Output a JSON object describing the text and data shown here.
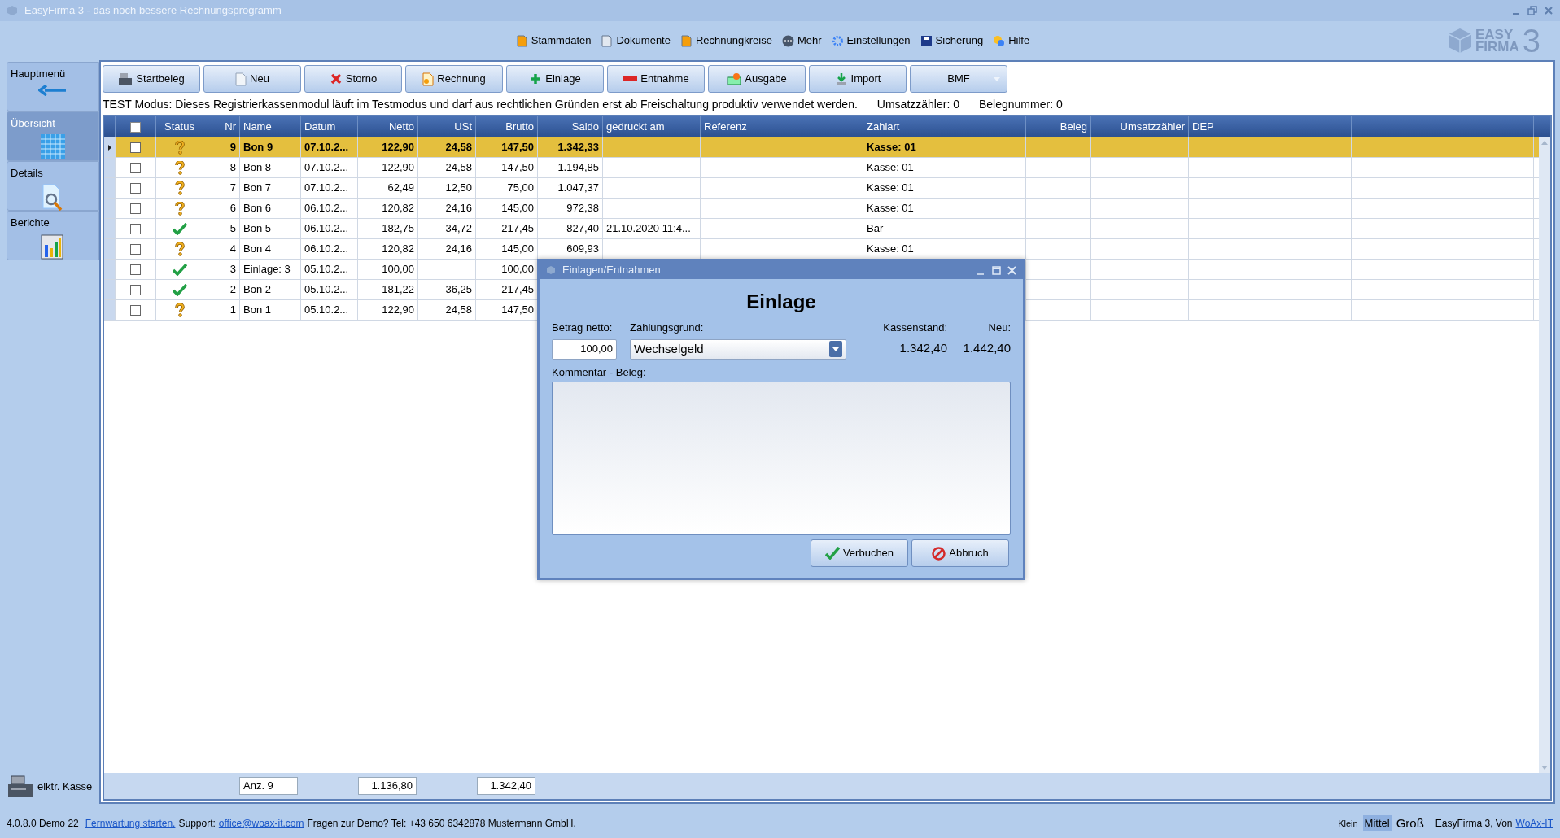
{
  "window": {
    "title": "EasyFirma 3 - das noch bessere Rechnungsprogramm"
  },
  "menu": [
    {
      "label": "Stammdaten"
    },
    {
      "label": "Dokumente"
    },
    {
      "label": "Rechnungkreise"
    },
    {
      "label": "Mehr"
    },
    {
      "label": "Einstellungen"
    },
    {
      "label": "Sicherung"
    },
    {
      "label": "Hilfe"
    }
  ],
  "logo": {
    "line1": "EASY",
    "line2": "FIRMA",
    "digit": "3"
  },
  "sidebar": {
    "items": [
      {
        "label": "Hauptmenü",
        "selected": false
      },
      {
        "label": "Übersicht",
        "selected": true
      },
      {
        "label": "Details",
        "selected": false
      },
      {
        "label": "Berichte",
        "selected": false
      }
    ],
    "footer": "elktr. Kasse"
  },
  "toolbar": [
    {
      "label": "Startbeleg",
      "dropdown": false
    },
    {
      "label": "Neu",
      "dropdown": false
    },
    {
      "label": "Storno",
      "dropdown": false
    },
    {
      "label": "Rechnung",
      "dropdown": false
    },
    {
      "label": "Einlage",
      "dropdown": false
    },
    {
      "label": "Entnahme",
      "dropdown": false
    },
    {
      "label": "Ausgabe",
      "dropdown": false
    },
    {
      "label": "Import",
      "dropdown": false
    },
    {
      "label": "BMF",
      "dropdown": true
    }
  ],
  "notice": "TEST Modus: Dieses Registrierkassenmodul läuft im Testmodus und darf aus rechtlichen Gründen erst ab Freischaltung produktiv verwendet werden.",
  "counters": [
    {
      "label": "Umsatzzähler:",
      "value": "0"
    },
    {
      "label": "Belegnummer:",
      "value": "0"
    }
  ],
  "table": {
    "select_all_checked": false,
    "columns": [
      "Status",
      "Nr",
      "Name",
      "Datum",
      "Netto",
      "USt",
      "Brutto",
      "Saldo",
      "gedruckt am",
      "Referenz",
      "Zahlart",
      "Beleg",
      "Umsatzzähler",
      "DEP"
    ],
    "rows": [
      {
        "selected": true,
        "checked": false,
        "kind": "open",
        "cells": [
          "",
          "9",
          "Bon 9",
          "07.10.2...",
          "122,90",
          "24,58",
          "147,50",
          "1.342,33",
          "",
          "",
          "Kasse: 01"
        ]
      },
      {
        "selected": false,
        "checked": false,
        "kind": "open",
        "cells": [
          "",
          "8",
          "Bon 8",
          "07.10.2...",
          "122,90",
          "24,58",
          "147,50",
          "1.194,85",
          "",
          "",
          "Kasse: 01"
        ]
      },
      {
        "selected": false,
        "checked": false,
        "kind": "open",
        "cells": [
          "",
          "7",
          "Bon 7",
          "07.10.2...",
          "62,49",
          "12,50",
          "75,00",
          "1.047,37",
          "",
          "",
          "Kasse: 01"
        ]
      },
      {
        "selected": false,
        "checked": false,
        "kind": "open",
        "cells": [
          "",
          "6",
          "Bon 6",
          "06.10.2...",
          "120,82",
          "24,16",
          "145,00",
          "972,38",
          "",
          "",
          "Kasse: 01"
        ]
      },
      {
        "selected": false,
        "checked": false,
        "kind": "done",
        "cells": [
          "",
          "5",
          "Bon 5",
          "06.10.2...",
          "182,75",
          "34,72",
          "217,45",
          "827,40",
          "21.10.2020 11:4...",
          "",
          "Bar"
        ]
      },
      {
        "selected": false,
        "checked": false,
        "kind": "open",
        "cells": [
          "",
          "4",
          "Bon 4",
          "06.10.2...",
          "120,82",
          "24,16",
          "145,00",
          "609,93",
          "",
          "",
          "Kasse: 01"
        ]
      },
      {
        "selected": false,
        "checked": false,
        "kind": "done",
        "cells": [
          "",
          "3",
          "Einlage: 3",
          "05.10.2...",
          "100,00",
          "",
          "100,00"
        ]
      },
      {
        "selected": false,
        "checked": false,
        "kind": "done",
        "cells": [
          "",
          "2",
          "Bon 2",
          "05.10.2...",
          "181,22",
          "36,25",
          "217,45"
        ]
      },
      {
        "selected": false,
        "checked": false,
        "kind": "open",
        "cells": [
          "",
          "1",
          "Bon 1",
          "05.10.2...",
          "122,90",
          "24,58",
          "147,50"
        ]
      }
    ],
    "totals": [
      "Anz. 9",
      "1.136,80",
      "1.342,40"
    ]
  },
  "dialog": {
    "title": "Einlagen/Entnahmen",
    "heading": "Einlage",
    "amount_label": "Betrag netto:",
    "amount": "100,00",
    "reason_label": "Zahlungsgrund:",
    "reason": "Wechselgeld",
    "balance_label": "Kassenstand:",
    "balance": "1.342,40",
    "new_label": "Neu:",
    "new_value": "1.442,40",
    "comment_label": "Kommentar - Beleg:",
    "buttons": [
      "Verbuchen",
      "Abbruch"
    ]
  },
  "status_bar": {
    "version": "4.0.8.0 Demo 22",
    "remote_link": "Fernwartung starten.",
    "support_label": "Support:",
    "email_link": "office@woax-it.com",
    "info": "Fragen zur Demo? Tel: +43 650 6342878 Mustermann GmbH.",
    "sizes": [
      {
        "label": "Klein",
        "selected": false
      },
      {
        "label": "Mittel",
        "selected": true
      },
      {
        "label": "Groß",
        "selected": false
      }
    ],
    "credit": "EasyFirma 3, Von",
    "credit_link": "WoAx-IT"
  }
}
